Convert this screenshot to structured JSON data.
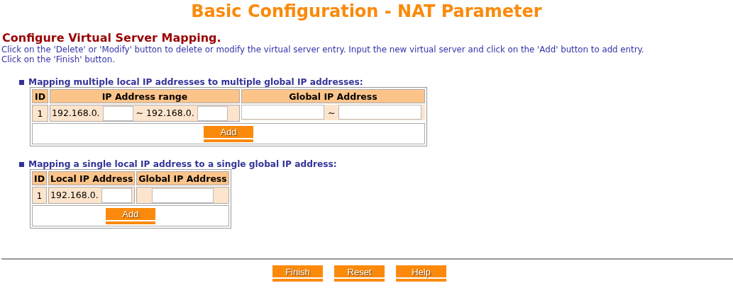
{
  "title": "Basic Configuration - NAT Parameter",
  "heading": "Configure Virtual Server Mapping.",
  "instructions": [
    "Click on the 'Delete' or 'Modify' button to delete or modify the virtual server entry. Input the new virtual server and click on the 'Add' button to add entry.",
    "Click on the 'Finish' button."
  ],
  "multiple_mapping": {
    "heading": "Mapping multiple local IP addresses to multiple global IP addresses:",
    "columns": [
      "ID",
      "IP Address range",
      "Global IP Address"
    ],
    "row": {
      "id": "1",
      "start_prefix": "192.168.0.",
      "range_separator": "~",
      "end_prefix": "192.168.0.",
      "global_separator": "~"
    },
    "button": "Add"
  },
  "single_mapping": {
    "heading": "Mapping a single local IP address to a single global IP address:",
    "columns": [
      "ID",
      "Local IP Address",
      "Global IP Address"
    ],
    "row": {
      "id": "1",
      "local_prefix": "192.168.0."
    },
    "button": "Add"
  },
  "buttons": [
    "Finish",
    "Reset",
    "Help"
  ]
}
